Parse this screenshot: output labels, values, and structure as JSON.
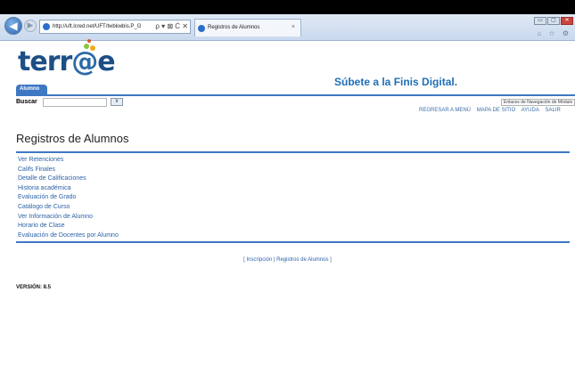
{
  "browser": {
    "address_url": "http://uft.lcred.net/UFT/twbkwbis.P_G",
    "address_tools": "ρ ▾ ⊠ Ċ ✕",
    "tab_title": "Registros de Alumnos",
    "tab_close": "×",
    "window_controls": [
      "▭",
      "▢",
      "✕"
    ],
    "home_star_gear": "⌂ ☆ ⚙",
    "back": "◀",
    "forward": "▶"
  },
  "header": {
    "logo_text_1": "terr",
    "logo_text_at": "@",
    "logo_text_2": "e",
    "tagline": "Súbete a la Finis Digital."
  },
  "nav": {
    "module_tab": "Alumno",
    "search_label": "Buscar",
    "search_value": "",
    "go_button": "Ir",
    "skip_links": "Enlaces de Navegación de Módulo",
    "top_links": [
      "REGRESAR A MENÚ",
      "MAPA DE SITIO",
      "AYUDA",
      "SALIR"
    ]
  },
  "main": {
    "page_title": "Registros de Alumnos",
    "menu_items": [
      "Ver Retenciones",
      "Califs Finales",
      "Detalle de Calificaciones",
      "Historia académica",
      "Evaluación de Grado",
      "Catálogo de Curso",
      "Ver Información de Alumno",
      "Horario de Clase",
      "Evaluación de Docentes por Alumno"
    ]
  },
  "footer": {
    "bracket_open": "[",
    "link_1": "Inscripción",
    "separator": "|",
    "link_2": "Registros de Alumnos",
    "bracket_close": "]",
    "version": "VERSIÓN: 8.5"
  },
  "colors": {
    "accent": "#3e78c4",
    "logo": "#1d4f86",
    "link": "#2d62a8"
  }
}
